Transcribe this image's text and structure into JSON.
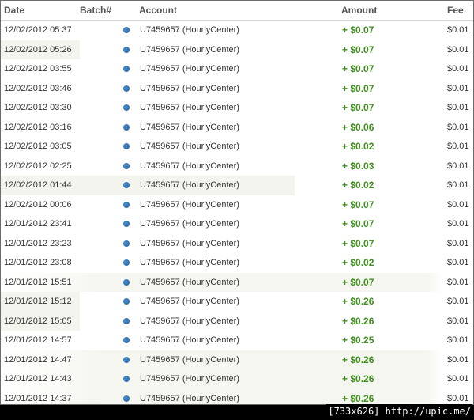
{
  "columns": {
    "date": "Date",
    "batch": "Batch#",
    "account": "Account",
    "amount": "Amount",
    "fee": "Fee"
  },
  "rows": [
    {
      "date": "12/02/2012 05:37",
      "account": "U7459657 (HourlyCenter)",
      "amount": "+ $0.07",
      "fee": "$0.01"
    },
    {
      "date": "12/02/2012 05:26",
      "account": "U7459657 (HourlyCenter)",
      "amount": "+ $0.07",
      "fee": "$0.01"
    },
    {
      "date": "12/02/2012 03:55",
      "account": "U7459657 (HourlyCenter)",
      "amount": "+ $0.07",
      "fee": "$0.01"
    },
    {
      "date": "12/02/2012 03:46",
      "account": "U7459657 (HourlyCenter)",
      "amount": "+ $0.07",
      "fee": "$0.01"
    },
    {
      "date": "12/02/2012 03:30",
      "account": "U7459657 (HourlyCenter)",
      "amount": "+ $0.07",
      "fee": "$0.01"
    },
    {
      "date": "12/02/2012 03:16",
      "account": "U7459657 (HourlyCenter)",
      "amount": "+ $0.06",
      "fee": "$0.01"
    },
    {
      "date": "12/02/2012 03:05",
      "account": "U7459657 (HourlyCenter)",
      "amount": "+ $0.02",
      "fee": "$0.01"
    },
    {
      "date": "12/02/2012 02:25",
      "account": "U7459657 (HourlyCenter)",
      "amount": "+ $0.03",
      "fee": "$0.01"
    },
    {
      "date": "12/02/2012 01:44",
      "account": "U7459657 (HourlyCenter)",
      "amount": "+ $0.02",
      "fee": "$0.01"
    },
    {
      "date": "12/02/2012 00:06",
      "account": "U7459657 (HourlyCenter)",
      "amount": "+ $0.07",
      "fee": "$0.01"
    },
    {
      "date": "12/01/2012 23:41",
      "account": "U7459657 (HourlyCenter)",
      "amount": "+ $0.07",
      "fee": "$0.01"
    },
    {
      "date": "12/01/2012 23:23",
      "account": "U7459657 (HourlyCenter)",
      "amount": "+ $0.07",
      "fee": "$0.01"
    },
    {
      "date": "12/01/2012 23:08",
      "account": "U7459657 (HourlyCenter)",
      "amount": "+ $0.02",
      "fee": "$0.01"
    },
    {
      "date": "12/01/2012 15:51",
      "account": "U7459657 (HourlyCenter)",
      "amount": "+ $0.07",
      "fee": "$0.01"
    },
    {
      "date": "12/01/2012 15:12",
      "account": "U7459657 (HourlyCenter)",
      "amount": "+ $0.26",
      "fee": "$0.01"
    },
    {
      "date": "12/01/2012 15:05",
      "account": "U7459657 (HourlyCenter)",
      "amount": "+ $0.26",
      "fee": "$0.01"
    },
    {
      "date": "12/01/2012 14:57",
      "account": "U7459657 (HourlyCenter)",
      "amount": "+ $0.25",
      "fee": "$0.01"
    },
    {
      "date": "12/01/2012 14:47",
      "account": "U7459657 (HourlyCenter)",
      "amount": "+ $0.26",
      "fee": "$0.01"
    },
    {
      "date": "12/01/2012 14:43",
      "account": "U7459657 (HourlyCenter)",
      "amount": "+ $0.26",
      "fee": "$0.01"
    },
    {
      "date": "12/01/2012 14:37",
      "account": "U7459657 (HourlyCenter)",
      "amount": "+ $0.26",
      "fee": "$0.01"
    }
  ],
  "badge": "[733x626] http://upic.me/",
  "colors": {
    "amount": "#3f8f1f",
    "status_dot": "#2a72b8",
    "row_alt": "#f4f4ee"
  },
  "icons": {
    "status": "status-dot-icon"
  }
}
